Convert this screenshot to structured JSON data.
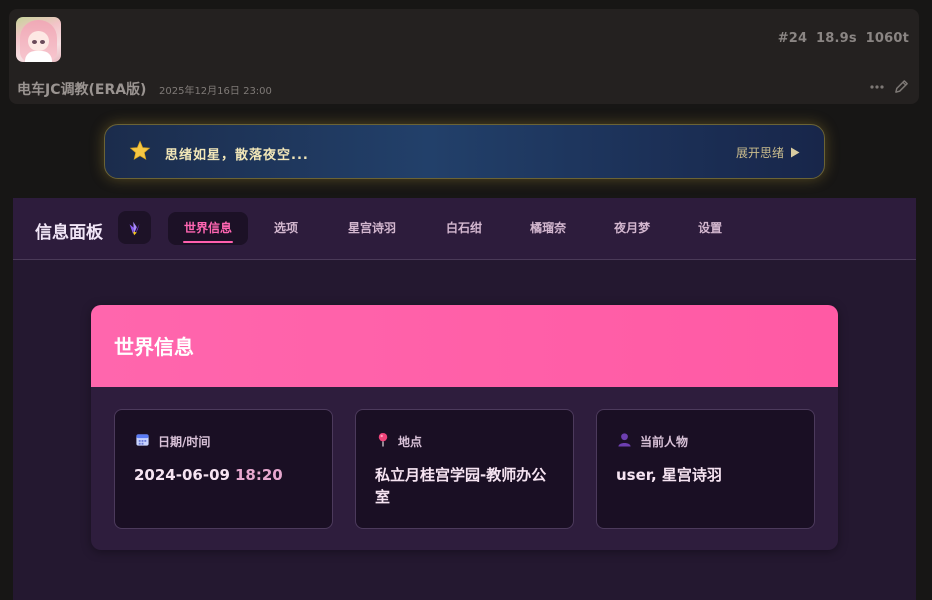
{
  "message": {
    "avatar_icon": "character-avatar",
    "stats": {
      "index": "#24",
      "duration": "18.9s",
      "tokens": "1060t"
    },
    "character_name": "电车JC调教(ERA版)",
    "timestamp": "2025年12月16日 23:00",
    "actions": {
      "more_icon": "more-dots-icon",
      "edit_icon": "pencil-icon"
    }
  },
  "thought": {
    "icon": "star-icon",
    "text": "思绪如星，散落夜空...",
    "expand_label": "展开思绪",
    "expand_icon": "play-triangle-icon"
  },
  "panel": {
    "title": "信息面板",
    "icon": "crystal-icon",
    "tabs": [
      {
        "label": "世界信息",
        "active": true
      },
      {
        "label": "选项",
        "active": false
      },
      {
        "label": "星宫诗羽",
        "active": false
      },
      {
        "label": "白石绀",
        "active": false
      },
      {
        "label": "橘瑠奈",
        "active": false
      },
      {
        "label": "夜月梦",
        "active": false
      },
      {
        "label": "设置",
        "active": false
      }
    ],
    "world": {
      "heading": "世界信息",
      "date": {
        "icon": "calendar-icon",
        "label": "日期/时间",
        "date": "2024-06-09",
        "time": "18:20"
      },
      "location": {
        "icon": "map-pin-icon",
        "label": "地点",
        "value": "私立月桂宫学园-教师办公室"
      },
      "characters": {
        "icon": "person-icon",
        "label": "当前人物",
        "value": "user, 星宫诗羽"
      }
    }
  },
  "colors": {
    "accent": "#ff5fae",
    "panel_bg": "#241830",
    "banner_glow": "#c8aa3c"
  }
}
